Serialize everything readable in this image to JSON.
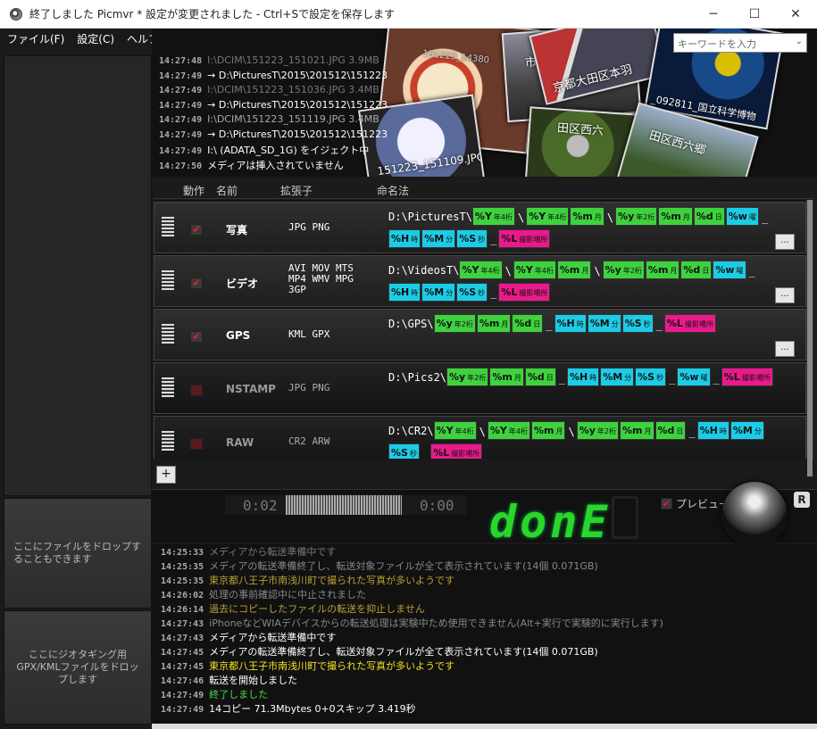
{
  "window": {
    "title": "終了しました Picmvr * 設定が変更されました - Ctrl+Sで設定を保存します",
    "min": "─",
    "max": "☐",
    "close": "✕"
  },
  "menu": [
    "ファイル(F)",
    "設定(C)",
    "ヘルプ(H)"
  ],
  "search": {
    "placeholder": "キーワードを入力"
  },
  "top_log": [
    {
      "ts": "14:27:48",
      "text": "I:\\DCIM\\151223_151021.JPG 3.9MB",
      "color": "#777"
    },
    {
      "ts": "14:27:49",
      "text": "→ D:\\PicturesT\\2015\\201512\\151223",
      "color": "#fff"
    },
    {
      "ts": "14:27:49",
      "text": "I:\\DCIM\\151223_151036.JPG 3.4MB",
      "color": "#777"
    },
    {
      "ts": "14:27:49",
      "text": "→ D:\\PicturesT\\2015\\201512\\151223",
      "color": "#fff"
    },
    {
      "ts": "14:27:49",
      "text": "I:\\DCIM\\151223_151119.JPG 3.4MB",
      "color": "#aaa"
    },
    {
      "ts": "14:27:49",
      "text": "→ D:\\PicturesT\\2015\\201512\\151223",
      "color": "#fff"
    },
    {
      "ts": "14:27:49",
      "text": "I:\\ (ADATA_SD_1G) をイジェクト中",
      "color": "#fff"
    },
    {
      "ts": "14:27:50",
      "text": "メディアは挿入されていません",
      "color": "#fff"
    }
  ],
  "photos": {
    "cap1": "151223_151109.JPG",
    "cap2": "151223_14380",
    "cap3": "_092811_国立科学博物",
    "cap4": "京都大田区本羽",
    "cap5": "市場町",
    "cap6": "田区西六",
    "cap7": "田区西六郷"
  },
  "table": {
    "headers": {
      "action": "動作",
      "name": "名前",
      "ext": "拡張子",
      "naming": "命名法"
    },
    "rules": [
      {
        "name": "写真",
        "ext": [
          "JPG PNG"
        ],
        "prefix": "D:\\PicturesT\\"
      },
      {
        "name": "ビデオ",
        "ext": [
          "AVI MOV MTS",
          "MP4 WMV MPG",
          "3GP"
        ],
        "prefix": "D:\\VideosT\\"
      },
      {
        "name": "GPS",
        "ext": [
          "KML GPX"
        ],
        "prefix": "D:\\GPS\\"
      },
      {
        "name": "NSTAMP",
        "ext": [
          "JPG PNG"
        ],
        "prefix": "D:\\Pics2\\"
      },
      {
        "name": "RAW",
        "ext": [
          "CR2 ARW"
        ],
        "prefix": "D:\\CR2\\"
      }
    ],
    "more_label": "...",
    "add_label": "+"
  },
  "tokens": {
    "Y4": {
      "code": "%Y",
      "sub": "年4桁"
    },
    "y2": {
      "code": "%y",
      "sub": "年2桁"
    },
    "m": {
      "code": "%m",
      "sub": "月"
    },
    "d": {
      "code": "%d",
      "sub": "日"
    },
    "w": {
      "code": "%w",
      "sub": "曜"
    },
    "H": {
      "code": "%H",
      "sub": "時"
    },
    "M": {
      "code": "%M",
      "sub": "分"
    },
    "S": {
      "code": "%S",
      "sub": "秒"
    },
    "L": {
      "code": "%L",
      "sub": "撮影場所"
    }
  },
  "left_panel": {
    "drop_files": "ここにファイルをドロップすることもできます",
    "drop_gpx": "ここにジオタギング用GPX/KMLファイルをドロップします"
  },
  "control": {
    "time_start": "0:02",
    "time_end": "0:00",
    "status": "donE",
    "preview_label": "プレビュー",
    "r_badge": "R"
  },
  "bottom_log": [
    {
      "ts": "14:25:33",
      "text": "メディアから転送準備中です",
      "color": "#777"
    },
    {
      "ts": "14:25:35",
      "text": "メディアの転送準備終了し、転送対象ファイルが全て表示されています(14個 0.071GB)",
      "color": "#888"
    },
    {
      "ts": "14:25:35",
      "text": "東京都八王子市南浅川町で撮られた写真が多いようです",
      "color": "#b8a030"
    },
    {
      "ts": "14:26:02",
      "text": "処理の事前確認中に中止されました",
      "color": "#888"
    },
    {
      "ts": "14:26:14",
      "text": "過去にコピーしたファイルの転送を抑止しません",
      "color": "#b8a030"
    },
    {
      "ts": "14:27:43",
      "text": "iPhoneなどWIAデバイスからの転送処理は実験中ため使用できません(Alt+実行で実験的に実行します)",
      "color": "#888"
    },
    {
      "ts": "14:27:43",
      "text": "メディアから転送準備中です",
      "color": "#fff"
    },
    {
      "ts": "14:27:45",
      "text": "メディアの転送準備終了し、転送対象ファイルが全て表示されています(14個 0.071GB)",
      "color": "#fff"
    },
    {
      "ts": "14:27:45",
      "text": "東京都八王子市南浅川町で撮られた写真が多いようです",
      "color": "#f0e020"
    },
    {
      "ts": "14:27:46",
      "text": "転送を開始しました",
      "color": "#fff"
    },
    {
      "ts": "14:27:49",
      "text": "終了しました",
      "color": "#4ad84a"
    },
    {
      "ts": "14:27:49",
      "text": "14コピー 71.3Mbytes 0+0スキップ 3.419秒",
      "color": "#fff"
    }
  ]
}
